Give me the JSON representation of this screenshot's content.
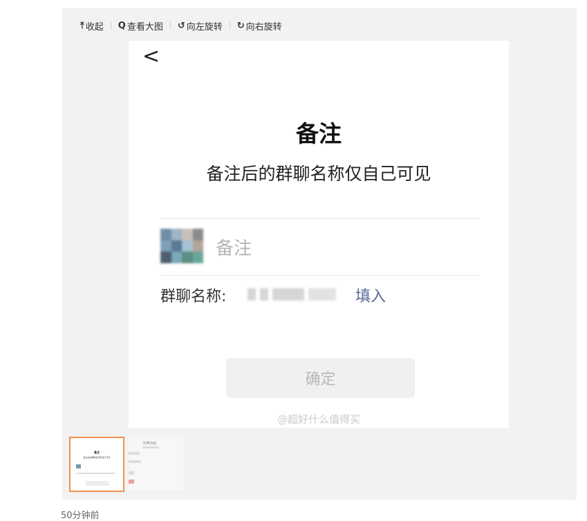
{
  "toolbar": {
    "collapse": {
      "icon": "collapse-up-icon",
      "glyph": "⤒",
      "label": "收起"
    },
    "view_large": {
      "icon": "magnifier-icon",
      "glyph": "Q",
      "label": "查看大图"
    },
    "rotate_left": {
      "icon": "rotate-left-icon",
      "glyph": "↺",
      "label": "向左旋转"
    },
    "rotate_right": {
      "icon": "rotate-right-icon",
      "glyph": "↻",
      "label": "向右旋转"
    }
  },
  "screenshot": {
    "back_glyph": "<",
    "title": "备注",
    "subtitle": "备注后的群聊名称仅自己可见",
    "remark_placeholder": "备注",
    "group_name_label": "群聊名称:",
    "fill_link": "填入",
    "confirm_label": "确定",
    "watermark": "@超好什么值得买"
  },
  "thumbnails": {
    "thumb1": {
      "title": "备注",
      "subtitle": "备注后的群聊名称仅自己可见"
    },
    "thumb2": {
      "text": "工作(16)"
    }
  },
  "timestamp": "50分钟前",
  "colors": {
    "accent": "#f29048",
    "link": "#576b95"
  }
}
